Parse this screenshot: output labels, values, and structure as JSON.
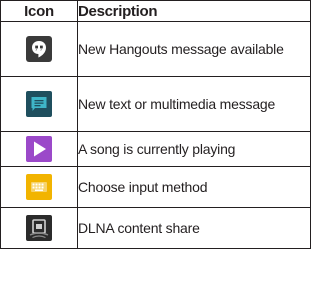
{
  "table": {
    "headers": {
      "icon": "Icon",
      "description": "Description"
    },
    "rows": [
      {
        "icon": "hangouts-message-icon",
        "description": "New Hangouts message available"
      },
      {
        "icon": "text-message-icon",
        "description": "New text or multimedia message"
      },
      {
        "icon": "play-icon",
        "description": "A song is currently playing"
      },
      {
        "icon": "keyboard-icon",
        "description": "Choose input method"
      },
      {
        "icon": "dlna-share-icon",
        "description": "DLNA content share"
      }
    ]
  },
  "colors": {
    "border": "#231f20",
    "hangouts_bg": "#3a3a3a",
    "message_bg": "#1f4f5e",
    "message_accent": "#3fb6c8",
    "play_bg": "#9b49c9",
    "keyboard_bg": "#f2b400",
    "dlna_bg": "#2b2b2b"
  }
}
